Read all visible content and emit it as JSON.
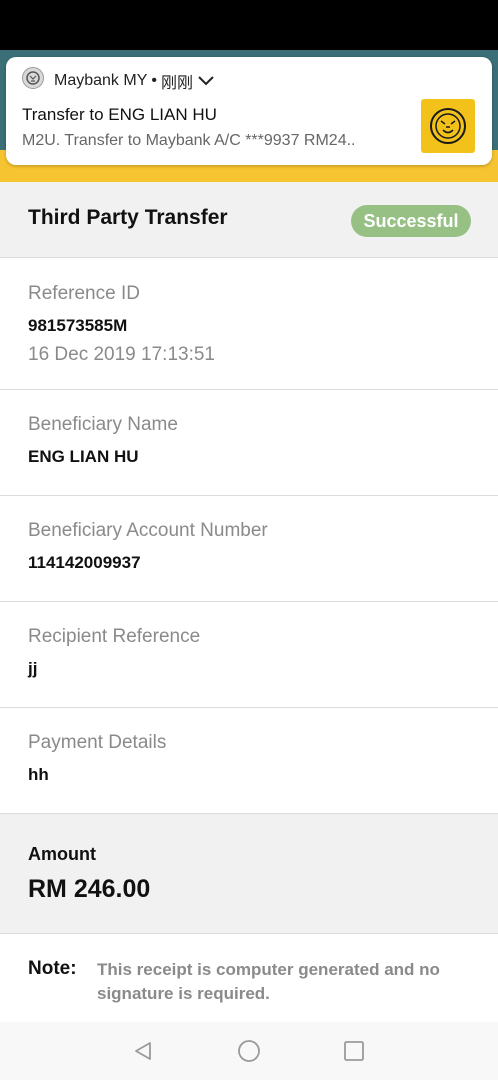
{
  "notification": {
    "app_name": "Maybank MY",
    "separator": "•",
    "time": "刚刚",
    "title": "Transfer to ENG LIAN HU",
    "body": "M2U. Transfer to Maybank A/C ***9937 RM24.."
  },
  "receipt": {
    "title": "Third Party Transfer",
    "status": "Successful",
    "reference_id_label": "Reference ID",
    "reference_id": "981573585M",
    "datetime": "16 Dec 2019 17:13:51",
    "beneficiary_name_label": "Beneficiary Name",
    "beneficiary_name": "ENG LIAN HU",
    "account_number_label": "Beneficiary Account Number",
    "account_number": "114142009937",
    "recipient_reference_label": "Recipient Reference",
    "recipient_reference": "jj",
    "payment_details_label": "Payment Details",
    "payment_details": "hh",
    "amount_label": "Amount",
    "amount": "RM 246.00",
    "note_label": "Note:",
    "note_text": "This receipt is computer generated and no signature is required."
  },
  "colors": {
    "brand_yellow": "#f6c431",
    "success_green": "#97c085",
    "header_teal": "#3a6f78"
  },
  "icons": {
    "app": "maybank-tiger-icon",
    "expand": "chevron-down-icon",
    "thumbnail": "maybank-tiger-logo",
    "nav_back": "back-triangle-icon",
    "nav_home": "home-circle-icon",
    "nav_recents": "recents-square-icon"
  }
}
